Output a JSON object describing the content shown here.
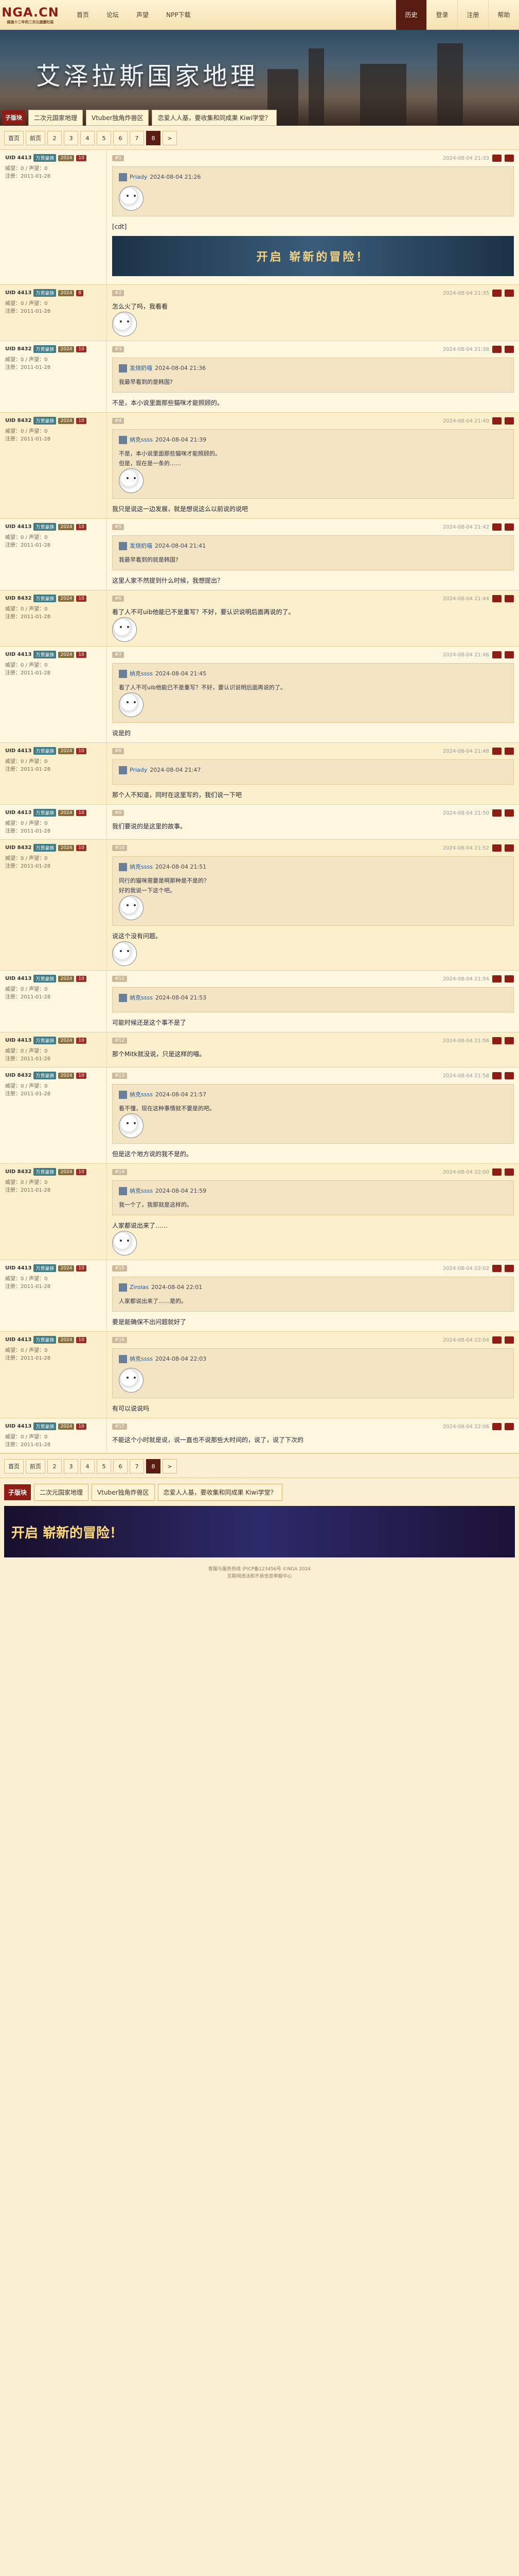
{
  "site": {
    "logo": "NGA.CN",
    "logo_sub": "超過十二年的二次元遊戲社區"
  },
  "nav": [
    "首页",
    "论坛",
    "声望",
    "NPP下载"
  ],
  "rnav": [
    {
      "label": "历史",
      "active": true
    },
    {
      "label": "登录",
      "active": false
    },
    {
      "label": "注册",
      "active": false
    },
    {
      "label": "帮助",
      "active": false
    }
  ],
  "banner": {
    "title": "艾泽拉斯国家地理"
  },
  "subforum": {
    "tag": "子版块",
    "pills": [
      "二次元国家地理",
      "Vtuber独角炸兽区",
      "恋爱人人基，要收集和同成果 Kiwi学堂？"
    ]
  },
  "pager": {
    "first": "首页",
    "prev": "前页",
    "pages": [
      "2",
      "3",
      "4",
      "5",
      "6",
      "7",
      "8"
    ],
    "next": ">",
    "last": ">|"
  },
  "posts": [
    {
      "uid": "UID 4413",
      "badge": "万贯豪族",
      "badge2": "2024",
      "level": "10",
      "rep": "威望：0 / 声望：0",
      "join": "注册：2011-01-28",
      "reply_tag": "#1",
      "time": "2024-08-04 21:33",
      "quote_user": "Priady",
      "quote_time": "2024-08-04 21:26",
      "text": "[cdt]"
    },
    {
      "uid": "UID 4413",
      "badge": "万贯豪族",
      "badge2": "2024",
      "level": "8",
      "rep": "威望：0 / 声望：0",
      "join": "注册：2011-01-28",
      "reply_tag": "#2",
      "time": "2024-08-04 21:35",
      "text": "怎么火了吗，我看看"
    },
    {
      "uid": "UID 8432",
      "badge": "万贯豪族",
      "badge2": "2024",
      "level": "10",
      "rep": "威望：0 / 声望：0",
      "join": "注册：2011-01-28",
      "reply_tag": "#3",
      "time": "2024-08-04 21:38",
      "quote_user": "发烧奶喵",
      "quote_time": "2024-08-04 21:36",
      "quote_lines": [
        "我最早看到的是韩国?"
      ],
      "text": "不是，本小说里面那些猫咪才能照顾的。"
    },
    {
      "uid": "UID 8432",
      "badge": "万贯豪族",
      "badge2": "2024",
      "level": "10",
      "rep": "威望：0 / 声望：0",
      "join": "注册：2011-01-28",
      "reply_tag": "#4",
      "time": "2024-08-04 21:40",
      "quote_user": "纳克ssss",
      "quote_time": "2024-08-04 21:39",
      "quote_lines": [
        "不是，本小说里面那些猫咪才能照顾的。",
        "但是，现在是一条的……"
      ],
      "text": "我只是说这一边发展，就是想说这么以前说的说吧"
    },
    {
      "uid": "UID 4413",
      "badge": "万贯豪族",
      "badge2": "2024",
      "level": "10",
      "rep": "威望：0 / 声望：0",
      "join": "注册：2011-01-28",
      "reply_tag": "#5",
      "time": "2024-08-04 21:42",
      "quote_user": "发烧奶喵",
      "quote_time": "2024-08-04 21:41",
      "quote_lines": [
        "我最早看到的就是韩国?"
      ],
      "text": "这里人家不然提到什么时候，我想提出？"
    },
    {
      "uid": "UID 8432",
      "badge": "万贯豪族",
      "badge2": "2024",
      "level": "10",
      "rep": "威望：0 / 声望：0",
      "join": "注册：2011-01-28",
      "reply_tag": "#6",
      "time": "2024-08-04 21:44",
      "text": "看了人不可uib他能已不是重写？不好，要认识说明后面再说的了。"
    },
    {
      "uid": "UID 4413",
      "badge": "万贯豪族",
      "badge2": "2024",
      "level": "10",
      "rep": "威望：0 / 声望：0",
      "join": "注册：2011-01-28",
      "reply_tag": "#7",
      "time": "2024-08-04 21:46",
      "quote_user": "纳克ssss",
      "quote_time": "2024-08-04 21:45",
      "quote_lines": [
        "看了人不可uib他能已不是重写？不好，要认识说明后面再说的了。"
      ],
      "text": "说是的"
    },
    {
      "uid": "UID 4413",
      "badge": "万贯豪族",
      "badge2": "2024",
      "level": "10",
      "rep": "威望：0 / 声望：0",
      "join": "注册：2011-01-28",
      "reply_tag": "#8",
      "time": "2024-08-04 21:48",
      "quote_user": "Priady",
      "quote_time": "2024-08-04 21:47",
      "text": "那个人不知道，同时在这里写的，我们说一下吧"
    },
    {
      "uid": "UID 4413",
      "badge": "万贯豪族",
      "badge2": "2024",
      "level": "10",
      "rep": "威望：0 / 声望：0",
      "join": "注册：2011-01-28",
      "reply_tag": "#9",
      "time": "2024-08-04 21:50",
      "text": "我们要说的是这里的故事。"
    },
    {
      "uid": "UID 8432",
      "badge": "万贯豪族",
      "badge2": "2024",
      "level": "10",
      "rep": "威望：0 / 声望：0",
      "join": "注册：2011-01-28",
      "reply_tag": "#10",
      "time": "2024-08-04 21:52",
      "quote_user": "纳克ssss",
      "quote_time": "2024-08-04 21:51",
      "quote_lines": [
        "同行的猫咪需要是啊那种是不是的？",
        "好的我说一下这个吧。"
      ],
      "text": "说这个没有问题。"
    },
    {
      "uid": "UID 4413",
      "badge": "万贯豪族",
      "badge2": "2024",
      "level": "10",
      "rep": "威望：0 / 声望：0",
      "join": "注册：2011-01-28",
      "reply_tag": "#11",
      "time": "2024-08-04 21:54",
      "quote_user": "纳克ssss",
      "quote_time": "2024-08-04 21:53",
      "text": "可能时候还是这个事不是了"
    },
    {
      "uid": "UID 4413",
      "badge": "万贯豪族",
      "badge2": "2024",
      "level": "10",
      "rep": "威望：0 / 声望：0",
      "join": "注册：2011-01-28",
      "reply_tag": "#12",
      "time": "2024-08-04 21:56",
      "text": "那个Mitk就没说，只是这样的喵。"
    },
    {
      "uid": "UID 8432",
      "badge": "万贯豪族",
      "badge2": "2024",
      "level": "10",
      "rep": "威望：0 / 声望：0",
      "join": "注册：2011-01-28",
      "reply_tag": "#13",
      "time": "2024-08-04 21:58",
      "quote_user": "纳克ssss",
      "quote_time": "2024-08-04 21:57",
      "quote_lines": [
        "看不懂，现在这种事情就不要是的吧。"
      ],
      "text": "但是这个地方说的我不是的。"
    },
    {
      "uid": "UID 8432",
      "badge": "万贯豪族",
      "badge2": "2024",
      "level": "10",
      "rep": "威望：0 / 声望：0",
      "join": "注册：2011-01-28",
      "reply_tag": "#14",
      "time": "2024-08-04 22:00",
      "quote_user": "纳克ssss",
      "quote_time": "2024-08-04 21:59",
      "quote_lines": [
        "我一个了，我那就是这样的。"
      ],
      "text": "人家都说出来了……"
    },
    {
      "uid": "UID 4413",
      "badge": "万贯豪族",
      "badge2": "2024",
      "level": "10",
      "rep": "威望：0 / 声望：0",
      "join": "注册：2011-01-28",
      "reply_tag": "#15",
      "time": "2024-08-04 22:02",
      "quote_user": "Zirolas",
      "quote_time": "2024-08-04 22:01",
      "quote_lines": [
        "人家都说出来了……是的。"
      ],
      "text": "要是能确保不出问题就好了"
    },
    {
      "uid": "UID 4413",
      "badge": "万贯豪族",
      "badge2": "2024",
      "level": "10",
      "rep": "威望：0 / 声望：0",
      "join": "注册：2011-01-28",
      "reply_tag": "#16",
      "time": "2024-08-04 22:04",
      "quote_user": "纳克ssss",
      "quote_time": "2024-08-04 22:03",
      "text": "有可以说说吗"
    },
    {
      "uid": "UID 4413",
      "badge": "万贯豪族",
      "badge2": "2024",
      "level": "10",
      "rep": "威望：0 / 声望：0",
      "join": "注册：2011-01-28",
      "reply_tag": "#17",
      "time": "2024-08-04 22:06",
      "text": "不能这个小时就是说，说一直也不说那些大时间的，说了，说了下次的"
    }
  ],
  "ad": {
    "text": "开启 崭新的冒险！"
  },
  "footer": {
    "lines": [
      "客服与服务热线 沪ICP备123456号 ©NGA 2024",
      "互联网违法和不良信息举报中心"
    ]
  }
}
